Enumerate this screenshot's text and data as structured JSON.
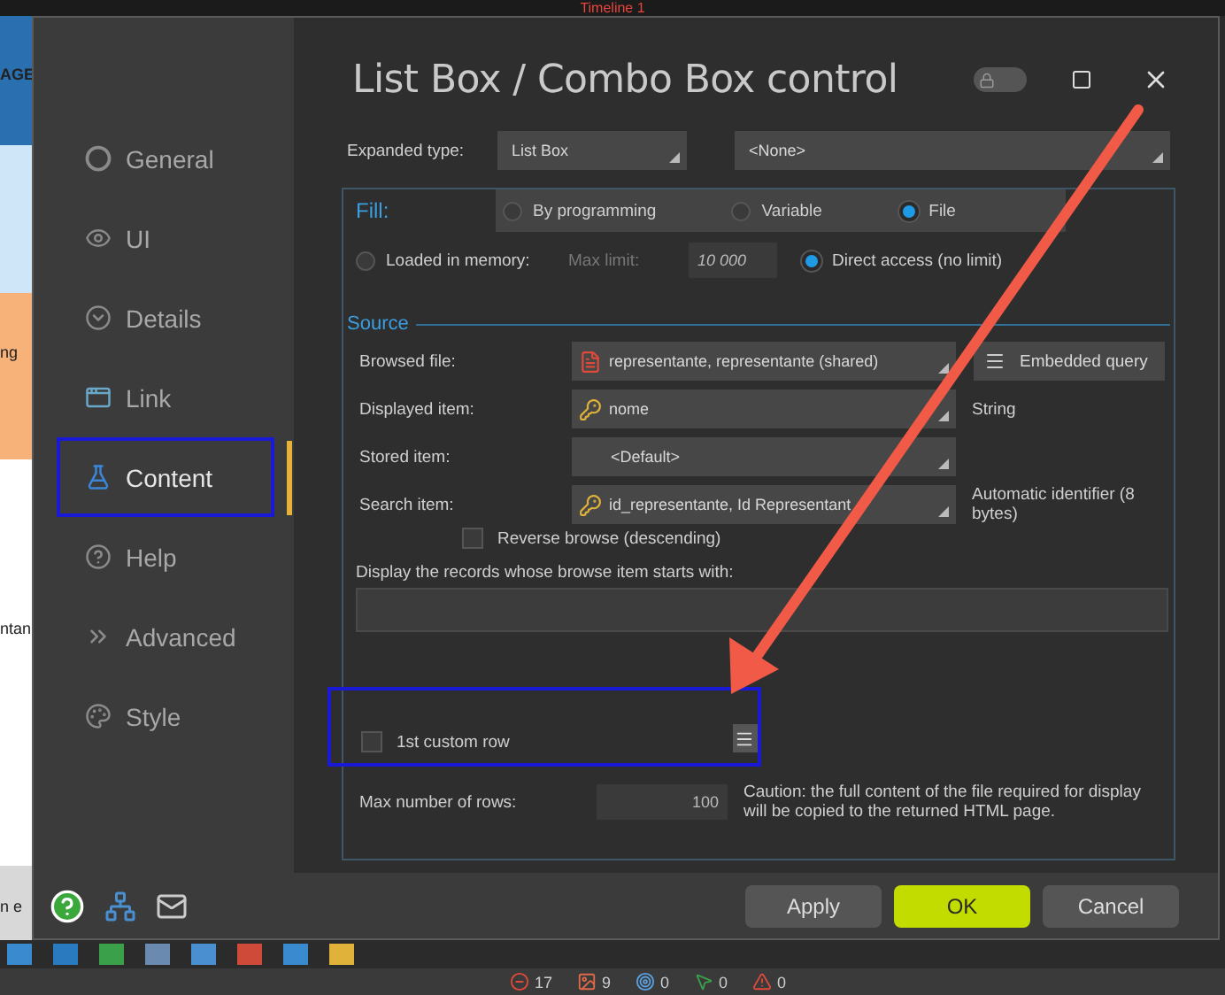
{
  "background_app": {
    "title": "Timeline 1",
    "fragments": [
      "AGE",
      "ng",
      "ntan",
      "n e"
    ]
  },
  "dialog": {
    "title": "List Box / Combo Box control",
    "locked": false
  },
  "sidebar": {
    "items": [
      {
        "label": "General",
        "selected": false,
        "highlighted": false
      },
      {
        "label": "UI",
        "selected": false,
        "highlighted": false
      },
      {
        "label": "Details",
        "selected": false,
        "highlighted": false
      },
      {
        "label": "Link",
        "selected": false,
        "highlighted": false
      },
      {
        "label": "Content",
        "selected": true,
        "highlighted": true
      },
      {
        "label": "Help",
        "selected": false,
        "highlighted": false
      },
      {
        "label": "Advanced",
        "selected": false,
        "highlighted": false
      },
      {
        "label": "Style",
        "selected": false,
        "highlighted": false
      }
    ]
  },
  "expanded_type": {
    "label": "Expanded type:",
    "value": "List Box",
    "second_value": "<None>"
  },
  "fill": {
    "title": "Fill:",
    "options": [
      {
        "label": "By programming",
        "selected": false
      },
      {
        "label": "Variable",
        "selected": false
      },
      {
        "label": "File",
        "selected": true
      }
    ],
    "loaded_in_memory": {
      "label": "Loaded in memory:",
      "selected": false
    },
    "max_limit_label": "Max limit:",
    "max_limit_value": "10 000",
    "direct_access": {
      "label": "Direct access (no limit)",
      "selected": true
    }
  },
  "source": {
    "title": "Source",
    "rows": [
      {
        "label": "Browsed file:",
        "value": "representante, representante (shared)",
        "button": "Embedded query"
      },
      {
        "label": "Displayed item:",
        "value": "nome",
        "note": "String"
      },
      {
        "label": "Stored item:",
        "value": "<Default>"
      },
      {
        "label": "Search item:",
        "value": "id_representante, Id Representant",
        "note": "Automatic identifier (8 bytes)"
      }
    ]
  },
  "reverse_browse": {
    "label": "Reverse browse (descending)",
    "checked": false
  },
  "filter": {
    "label": "Display the records whose browse item starts with:"
  },
  "custom_row": {
    "label": "1st custom row",
    "checked": false,
    "highlighted": true
  },
  "max_rows": {
    "label": "Max number of rows:",
    "value": "100",
    "caution": "Caution: the full content of the file required for display will be copied to the returned HTML page."
  },
  "buttons": [
    {
      "label": "Apply",
      "kind": "normal"
    },
    {
      "label": "OK",
      "kind": "primary"
    },
    {
      "label": "Cancel",
      "kind": "normal"
    }
  ],
  "status_bar": [
    {
      "count": "17"
    },
    {
      "count": "9"
    },
    {
      "count": "0"
    },
    {
      "count": "0"
    },
    {
      "count": "0"
    }
  ]
}
